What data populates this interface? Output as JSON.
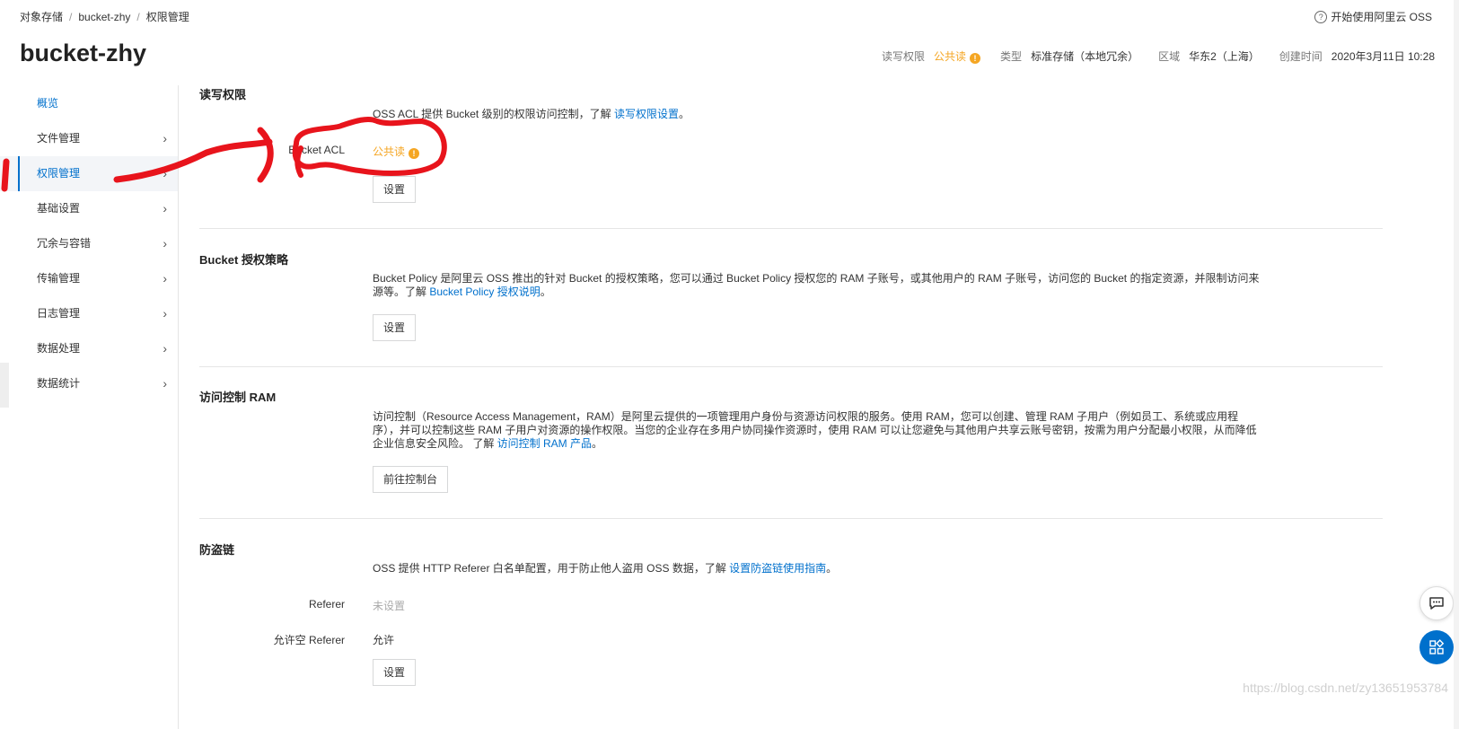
{
  "breadcrumb": [
    "对象存储",
    "bucket-zhy",
    "权限管理"
  ],
  "breadcrumb_sep": "/",
  "help_link": "开始使用阿里云 OSS",
  "bucket_name": "bucket-zhy",
  "meta": {
    "acl_label": "读写权限",
    "acl_value": "公共读",
    "type_label": "类型",
    "type_value": "标准存储（本地冗余）",
    "region_label": "区域",
    "region_value": "华东2（上海）",
    "created_label": "创建时间",
    "created_value": "2020年3月11日 10:28"
  },
  "sidebar": {
    "items": [
      {
        "label": "概览"
      },
      {
        "label": "文件管理"
      },
      {
        "label": "权限管理"
      },
      {
        "label": "基础设置"
      },
      {
        "label": "冗余与容错"
      },
      {
        "label": "传输管理"
      },
      {
        "label": "日志管理"
      },
      {
        "label": "数据处理"
      },
      {
        "label": "数据统计"
      }
    ]
  },
  "sections": {
    "acl": {
      "title": "读写权限",
      "desc": "OSS ACL 提供 Bucket 级别的权限访问控制，了解 ",
      "link": "读写权限设置",
      "desc_end": "。",
      "field_label": "Bucket ACL",
      "field_value": "公共读",
      "button": "设置"
    },
    "policy": {
      "title": "Bucket 授权策略",
      "desc": "Bucket Policy 是阿里云 OSS 推出的针对 Bucket 的授权策略，您可以通过 Bucket Policy 授权您的 RAM 子账号，或其他用户的 RAM 子账号，访问您的 Bucket 的指定资源，并限制访问来源等。了解 ",
      "link": "Bucket Policy 授权说明",
      "desc_end": "。",
      "button": "设置"
    },
    "ram": {
      "title": "访问控制 RAM",
      "desc": "访问控制（Resource Access Management，RAM）是阿里云提供的一项管理用户身份与资源访问权限的服务。使用 RAM，您可以创建、管理 RAM 子用户（例如员工、系统或应用程序），并可以控制这些 RAM 子用户对资源的操作权限。当您的企业存在多用户协同操作资源时，使用 RAM 可以让您避免与其他用户共享云账号密钥，按需为用户分配最小权限，从而降低企业信息安全风险。 了解 ",
      "link": "访问控制 RAM 产品",
      "desc_end": "。",
      "button": "前往控制台"
    },
    "referer": {
      "title": "防盗链",
      "desc": "OSS 提供 HTTP Referer 白名单配置，用于防止他人盗用 OSS 数据，了解 ",
      "link": "设置防盗链使用指南",
      "desc_end": "。",
      "referer_label": "Referer",
      "referer_value": "未设置",
      "empty_label": "允许空 Referer",
      "empty_value": "允许",
      "button": "设置"
    }
  },
  "watermark": "https://blog.csdn.net/zy13651953784",
  "colors": {
    "accent": "#0070cc",
    "warning": "#f5a623",
    "annotation": "#e8141c"
  },
  "icons": {
    "help": "question-circle-icon",
    "warn": "exclamation-circle-icon",
    "chevron": "chevron-right-icon",
    "chat": "chat-icon",
    "apps": "apps-icon"
  }
}
